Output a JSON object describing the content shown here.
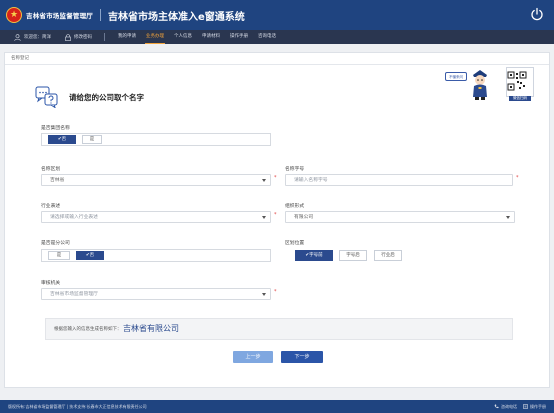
{
  "header": {
    "org_name": "吉林省市场监督管理厅",
    "system_title": "吉林省市场主体准入e窗通系统"
  },
  "nav": {
    "welcome": "欢迎您：简洋",
    "change_password": "修改密码",
    "items": [
      "我的申请",
      "业务办理",
      "个人信息",
      "申请材料",
      "操作手册",
      "咨询电话"
    ],
    "active_index": 1
  },
  "breadcrumb": "名称登记",
  "headline": "请给您的公司取个名字",
  "mascot_bubble": "不懂来问",
  "qr_label": "微信扫码",
  "form": {
    "group_name": {
      "label": "是否集团名称",
      "options": [
        "否",
        "是"
      ],
      "selected": 0
    },
    "region": {
      "label": "名称区划",
      "value": "吉林省"
    },
    "trade_name": {
      "label": "名称字号",
      "placeholder": "请输入名称字号"
    },
    "industry": {
      "label": "行业表述",
      "placeholder": "请选择或输入行业表述"
    },
    "org_form": {
      "label": "组织形式",
      "value": "有限公司"
    },
    "branch_company": {
      "label": "是否是分公司",
      "options": [
        "是",
        "否"
      ],
      "selected": 1
    },
    "district_position": {
      "label": "区划位置",
      "options": [
        "字号前",
        "字号后",
        "行业后"
      ],
      "selected": 0
    },
    "registration_authority": {
      "label": "审核机关",
      "value": "吉林省市场监督管理厅"
    },
    "required_mark": "*"
  },
  "preview": {
    "label": "根据您输入的信息生成名称如下：",
    "value": "吉林省有限公司"
  },
  "buttons": {
    "prev": "上一步",
    "next": "下一步"
  },
  "footer": {
    "copyright": "版权所有:吉林省市场监督管理厅 | 技术支持:长春市大正信息技术有限责任公司",
    "consult_phone": "咨询电话",
    "manual": "操作手册"
  },
  "colors": {
    "header_bg": "#1f4480",
    "nav_bg": "#2a3650",
    "accent": "#f3a33a",
    "primary": "#2b4a8e",
    "preview_text": "#2b4a8e"
  }
}
